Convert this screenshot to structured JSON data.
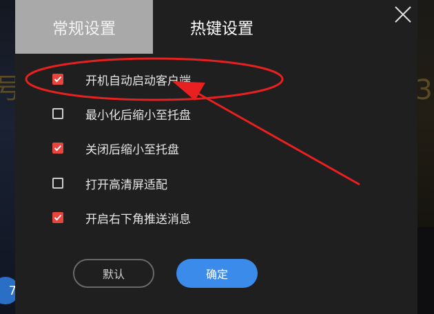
{
  "background": {
    "glyph_left": "号",
    "glyph_right": "3",
    "circle_glyph": "7"
  },
  "tabs": [
    {
      "label": "常规设置",
      "active": true
    },
    {
      "label": "热键设置",
      "active": false
    }
  ],
  "options": [
    {
      "label": "开机自动启动客户端",
      "checked": true
    },
    {
      "label": "最小化后缩小至托盘",
      "checked": false
    },
    {
      "label": "关闭后缩小至托盘",
      "checked": true
    },
    {
      "label": "打开高清屏适配",
      "checked": false
    },
    {
      "label": "开启右下角推送消息",
      "checked": true
    }
  ],
  "buttons": {
    "default_label": "默认",
    "ok_label": "确定"
  },
  "colors": {
    "accent": "#e8453c",
    "primary_button": "#3b8beb",
    "annotation": "#e82020"
  }
}
